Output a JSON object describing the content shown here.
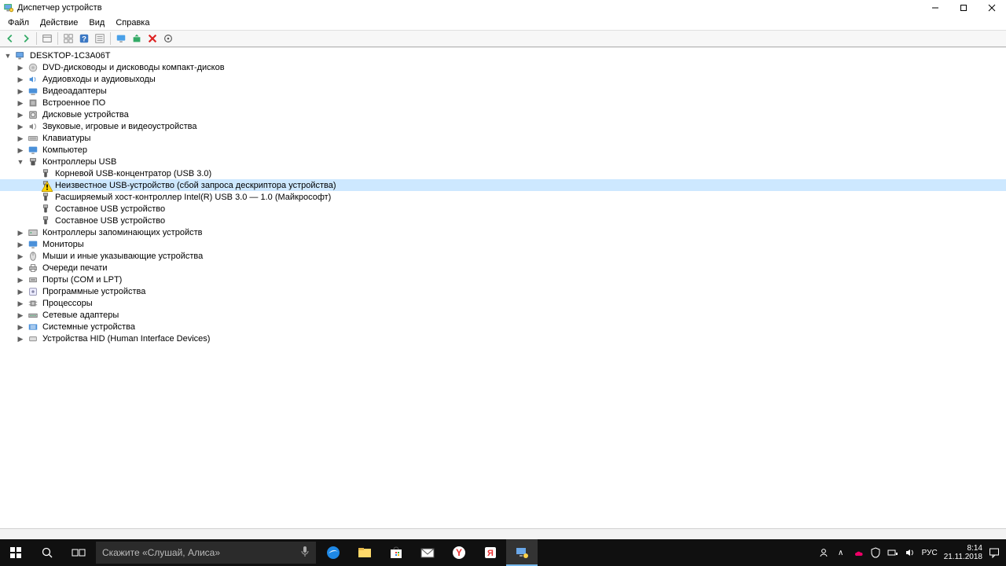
{
  "window": {
    "title": "Диспетчер устройств"
  },
  "menu": {
    "file": "Файл",
    "action": "Действие",
    "view": "Вид",
    "help": "Справка"
  },
  "tree": {
    "root": "DESKTOP-1C3A06T",
    "cats": {
      "dvd": "DVD-дисководы и дисководы компакт-дисков",
      "audio": "Аудиовходы и аудиовыходы",
      "video": "Видеоадаптеры",
      "firmware": "Встроенное ПО",
      "disk": "Дисковые устройства",
      "sound": "Звуковые, игровые и видеоустройства",
      "keyboard": "Клавиатуры",
      "computer": "Компьютер",
      "usb": "Контроллеры USB",
      "storage": "Контроллеры запоминающих устройств",
      "monitor": "Мониторы",
      "mouse": "Мыши и иные указывающие устройства",
      "printq": "Очереди печати",
      "ports": "Порты (COM и LPT)",
      "software": "Программные устройства",
      "cpu": "Процессоры",
      "net": "Сетевые адаптеры",
      "system": "Системные устройства",
      "hid": "Устройства HID (Human Interface Devices)"
    },
    "usb_children": {
      "hub": "Корневой USB-концентратор (USB 3.0)",
      "unknown": "Неизвестное USB-устройство (сбой запроса дескриптора устройства)",
      "hostctl": "Расширяемый хост-контроллер Intel(R) USB 3.0 — 1.0 (Майкрософт)",
      "comp1": "Составное USB устройство",
      "comp2": "Составное USB устройство"
    }
  },
  "taskbar": {
    "search_placeholder": "Скажите «Слушай, Алиса»",
    "lang": "РУС",
    "time": "8:14",
    "date": "21.11.2018"
  }
}
